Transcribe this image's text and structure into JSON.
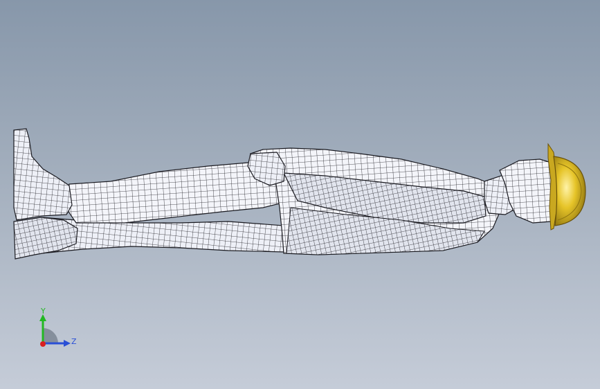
{
  "viewport": {
    "background_top": "#8797aa",
    "background_bottom": "#c5ccd8"
  },
  "model": {
    "icon": "human-figure-wireframe",
    "mesh_fill": "#f4f5fa",
    "mesh_line": "#1e1e24",
    "helmet_color": "#e6c428"
  },
  "triad": {
    "y_label": "Y",
    "z_label": "Z",
    "y_color": "#22b822",
    "z_color": "#2a4fd6",
    "origin_color": "#d82020"
  }
}
